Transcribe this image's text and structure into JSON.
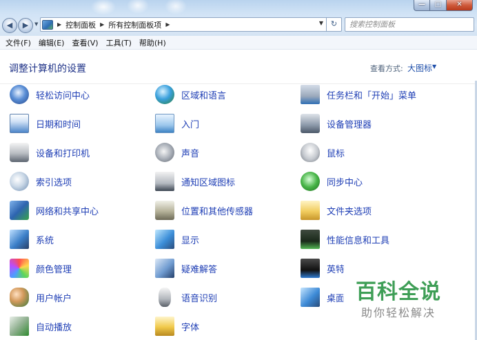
{
  "window": {
    "minimize_glyph": "—",
    "maximize_glyph": "□",
    "close_glyph": "✕"
  },
  "navigation": {
    "back_glyph": "◀",
    "forward_glyph": "▶",
    "breadcrumbs": [
      "控制面板",
      "所有控制面板项"
    ],
    "search_placeholder": "搜索控制面板"
  },
  "menu": [
    "文件(F)",
    "编辑(E)",
    "查看(V)",
    "工具(T)",
    "帮助(H)"
  ],
  "header": {
    "title": "调整计算机的设置",
    "view_by_label": "查看方式:",
    "view_by_value": "大图标"
  },
  "items": [
    {
      "label": "轻松访问中心",
      "icon": "ease-of-access-icon",
      "col": 0,
      "row": 0
    },
    {
      "label": "区域和语言",
      "icon": "region-language-icon",
      "col": 1,
      "row": 0
    },
    {
      "label": "任务栏和「开始」菜单",
      "icon": "taskbar-start-menu-icon",
      "col": 2,
      "row": 0
    },
    {
      "label": "日期和时间",
      "icon": "date-time-icon",
      "col": 0,
      "row": 1
    },
    {
      "label": "入门",
      "icon": "getting-started-icon",
      "col": 1,
      "row": 1
    },
    {
      "label": "设备管理器",
      "icon": "device-manager-icon",
      "col": 2,
      "row": 1
    },
    {
      "label": "设备和打印机",
      "icon": "devices-printers-icon",
      "col": 0,
      "row": 2
    },
    {
      "label": "声音",
      "icon": "sound-icon",
      "col": 1,
      "row": 2
    },
    {
      "label": "鼠标",
      "icon": "mouse-icon",
      "col": 2,
      "row": 2
    },
    {
      "label": "索引选项",
      "icon": "indexing-options-icon",
      "col": 0,
      "row": 3
    },
    {
      "label": "通知区域图标",
      "icon": "notification-area-icon",
      "col": 1,
      "row": 3
    },
    {
      "label": "同步中心",
      "icon": "sync-center-icon",
      "col": 2,
      "row": 3
    },
    {
      "label": "网络和共享中心",
      "icon": "network-sharing-icon",
      "col": 0,
      "row": 4
    },
    {
      "label": "位置和其他传感器",
      "icon": "location-sensors-icon",
      "col": 1,
      "row": 4
    },
    {
      "label": "文件夹选项",
      "icon": "folder-options-icon",
      "col": 2,
      "row": 4
    },
    {
      "label": "系统",
      "icon": "system-icon",
      "col": 0,
      "row": 5
    },
    {
      "label": "显示",
      "icon": "display-icon",
      "col": 1,
      "row": 5
    },
    {
      "label": "性能信息和工具",
      "icon": "performance-icon",
      "col": 2,
      "row": 5
    },
    {
      "label": "颜色管理",
      "icon": "color-management-icon",
      "col": 0,
      "row": 6
    },
    {
      "label": "疑难解答",
      "icon": "troubleshooting-icon",
      "col": 1,
      "row": 6
    },
    {
      "label": "英特",
      "icon": "graphics-icon",
      "col": 2,
      "row": 6
    },
    {
      "label": "用户帐户",
      "icon": "user-accounts-icon",
      "col": 0,
      "row": 7
    },
    {
      "label": "语音识别",
      "icon": "speech-recognition-icon",
      "col": 1,
      "row": 7
    },
    {
      "label": "桌面",
      "icon": "desktop-gadgets-icon",
      "col": 2,
      "row": 7
    },
    {
      "label": "自动播放",
      "icon": "autoplay-icon",
      "col": 0,
      "row": 8
    },
    {
      "label": "字体",
      "icon": "fonts-icon",
      "col": 1,
      "row": 8
    }
  ],
  "watermark": {
    "title": "百科全说",
    "subtitle": "助你轻松解决"
  },
  "colors": {
    "link": "#1f3fb5",
    "title": "#1e3287",
    "watermark_green": "#3e9e56"
  }
}
